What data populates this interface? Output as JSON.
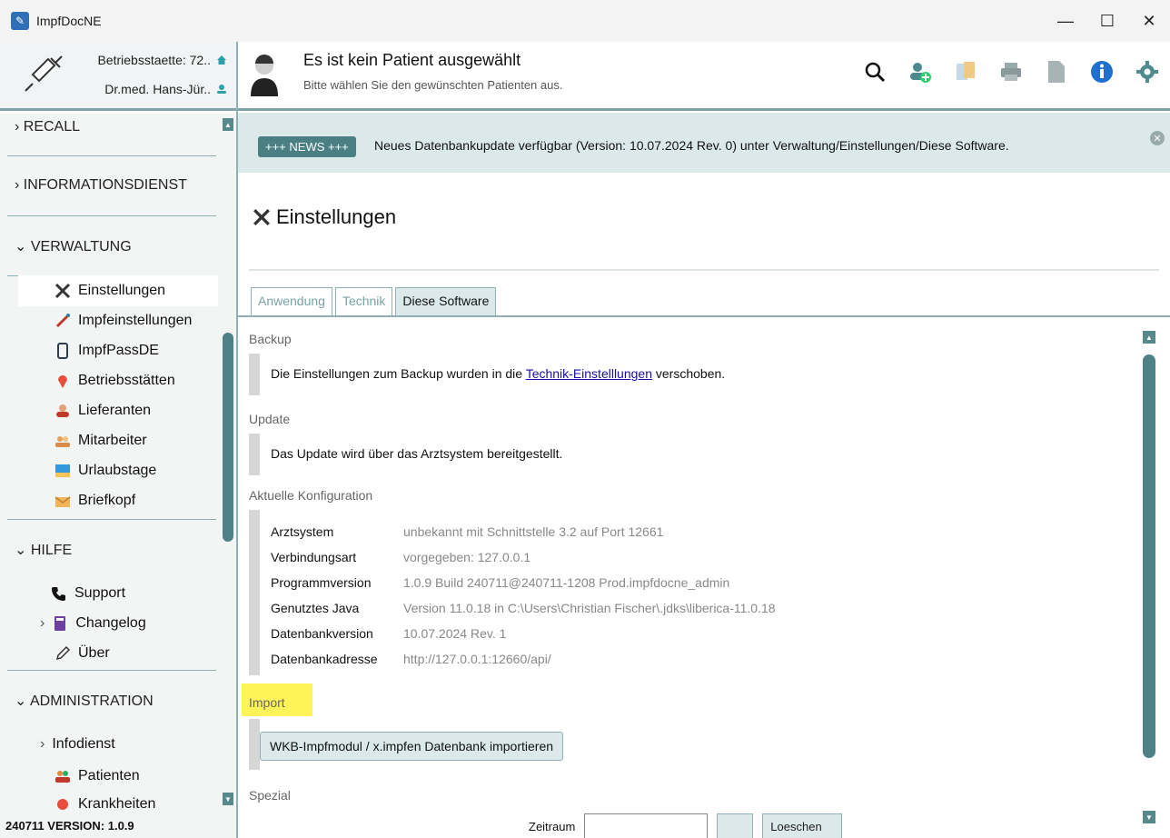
{
  "window": {
    "title": "ImpfDocNE",
    "controls": {
      "minimize": "—",
      "maximize": "☐",
      "close": "✕"
    }
  },
  "left_header": {
    "site": "Betriebsstaette: 72..",
    "doctor": "Dr.med. Hans-Jür.."
  },
  "sidebar": {
    "sections": [
      {
        "label": "› RECALL"
      },
      {
        "label": "› INFORMATIONSDIENST"
      },
      {
        "label": "⌄ VERWALTUNG"
      },
      {
        "label": "⌄ HILFE"
      },
      {
        "label": "⌄ ADMINISTRATION"
      }
    ],
    "verwaltung_items": [
      {
        "label": "Einstellungen",
        "icon": "tools-icon"
      },
      {
        "label": "Impfeinstellungen",
        "icon": "syringe-icon"
      },
      {
        "label": "ImpfPassDE",
        "icon": "phone-icon"
      },
      {
        "label": "Betriebsstätten",
        "icon": "location-pin-icon"
      },
      {
        "label": "Lieferanten",
        "icon": "supplier-icon"
      },
      {
        "label": "Mitarbeiter",
        "icon": "staff-icon"
      },
      {
        "label": "Urlaubstage",
        "icon": "vacation-icon"
      },
      {
        "label": "Briefkopf",
        "icon": "letter-icon"
      }
    ],
    "hilfe_items": [
      {
        "label": "Support",
        "icon": "phone-handset-icon"
      },
      {
        "label": "Changelog",
        "icon": "book-icon",
        "prefix": "›"
      },
      {
        "label": "Über",
        "icon": "pen-icon"
      }
    ],
    "admin_items": [
      {
        "label": "Infodienst",
        "prefix": "›"
      },
      {
        "label": "Patienten",
        "icon": "patients-icon"
      },
      {
        "label": "Krankheiten",
        "icon": "disease-icon"
      }
    ],
    "version": "240711 VERSION: 1.0.9"
  },
  "header": {
    "patient_title": "Es ist kein Patient ausgewählt",
    "patient_sub": "Bitte wählen Sie den gewünschten Patienten aus."
  },
  "news": {
    "badge": "+++ NEWS +++",
    "text": "Neues Datenbankupdate verfügbar (Version: 10.07.2024 Rev. 0) unter Verwaltung/Einstellungen/Diese Software."
  },
  "page": {
    "title": "Einstellungen",
    "tabs": [
      "Anwendung",
      "Technik",
      "Diese Software"
    ]
  },
  "content": {
    "backup_label": "Backup",
    "backup_text_pre": "Die Einstellungen zum Backup wurden in die ",
    "backup_link": "Technik-Einstelllungen",
    "backup_text_post": " verschoben.",
    "update_label": "Update",
    "update_text": "Das Update wird über das Arztsystem bereitgestellt.",
    "config_label": "Aktuelle Konfiguration",
    "config": [
      {
        "key": "Arztsystem",
        "value": "unbekannt mit Schnittstelle 3.2 auf Port 12661"
      },
      {
        "key": "Verbindungsart",
        "value": "vorgegeben: 127.0.0.1"
      },
      {
        "key": "Programmversion",
        "value": "1.0.9 Build 240711@240711-1208 Prod.impfdocne_admin"
      },
      {
        "key": "Genutztes Java",
        "value": "Version 11.0.18 in C:\\Users\\Christian Fischer\\.jdks\\liberica-11.0.18"
      },
      {
        "key": "Datenbankversion",
        "value": "10.07.2024 Rev. 1"
      },
      {
        "key": "Datenbankadresse",
        "value": "http://127.0.0.1:12660/api/"
      }
    ],
    "import_label": "Import",
    "import_button": "WKB-Impfmodul / x.impfen Datenbank importieren",
    "spezial_label": "Spezial",
    "spezial_field_label": "Zeitraum",
    "spezial_button": "Loeschen"
  },
  "colors": {
    "accent": "#4a7f84",
    "news_bg": "#dbe9ea",
    "highlight": "#fff35a"
  }
}
